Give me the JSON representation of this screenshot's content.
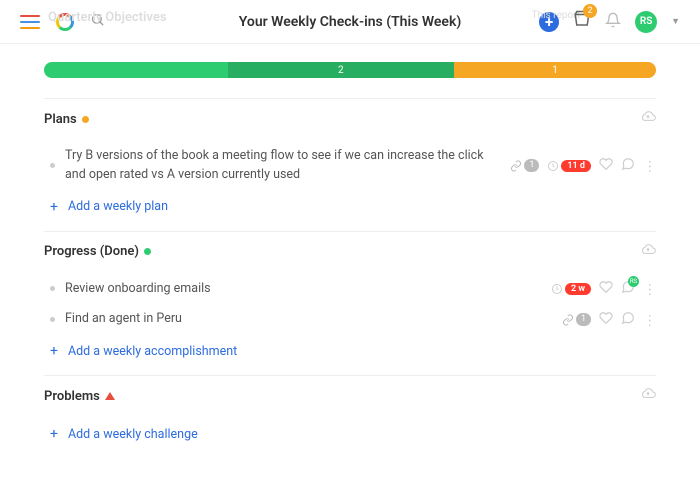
{
  "header": {
    "ghost_title": "Quarterly Objectives",
    "ghost_right": "This report",
    "title": "Your Weekly Check-ins (This Week)",
    "basket_count": "2",
    "avatar": "RS"
  },
  "progress": {
    "seg1": {
      "width": "30%",
      "label": ""
    },
    "seg2": {
      "width": "37%",
      "label": "2"
    },
    "seg3": {
      "width": "33%",
      "label": "1"
    }
  },
  "sections": {
    "plans": {
      "title": "Plans",
      "items": [
        {
          "text": "Try B versions of the book a meeting flow to see if we can increase the click and open rated vs A version currently used",
          "link_count": "1",
          "date_pill": "11 d"
        }
      ],
      "add_label": "Add a weekly plan"
    },
    "progress_done": {
      "title": "Progress (Done)",
      "items": [
        {
          "text": "Review onboarding emails",
          "date_pill": "2 w",
          "comment_avatar": "RS"
        },
        {
          "text": "Find an agent in Peru",
          "link_count": "1"
        }
      ],
      "add_label": "Add a weekly accomplishment"
    },
    "problems": {
      "title": "Problems",
      "add_label": "Add a weekly challenge"
    }
  }
}
